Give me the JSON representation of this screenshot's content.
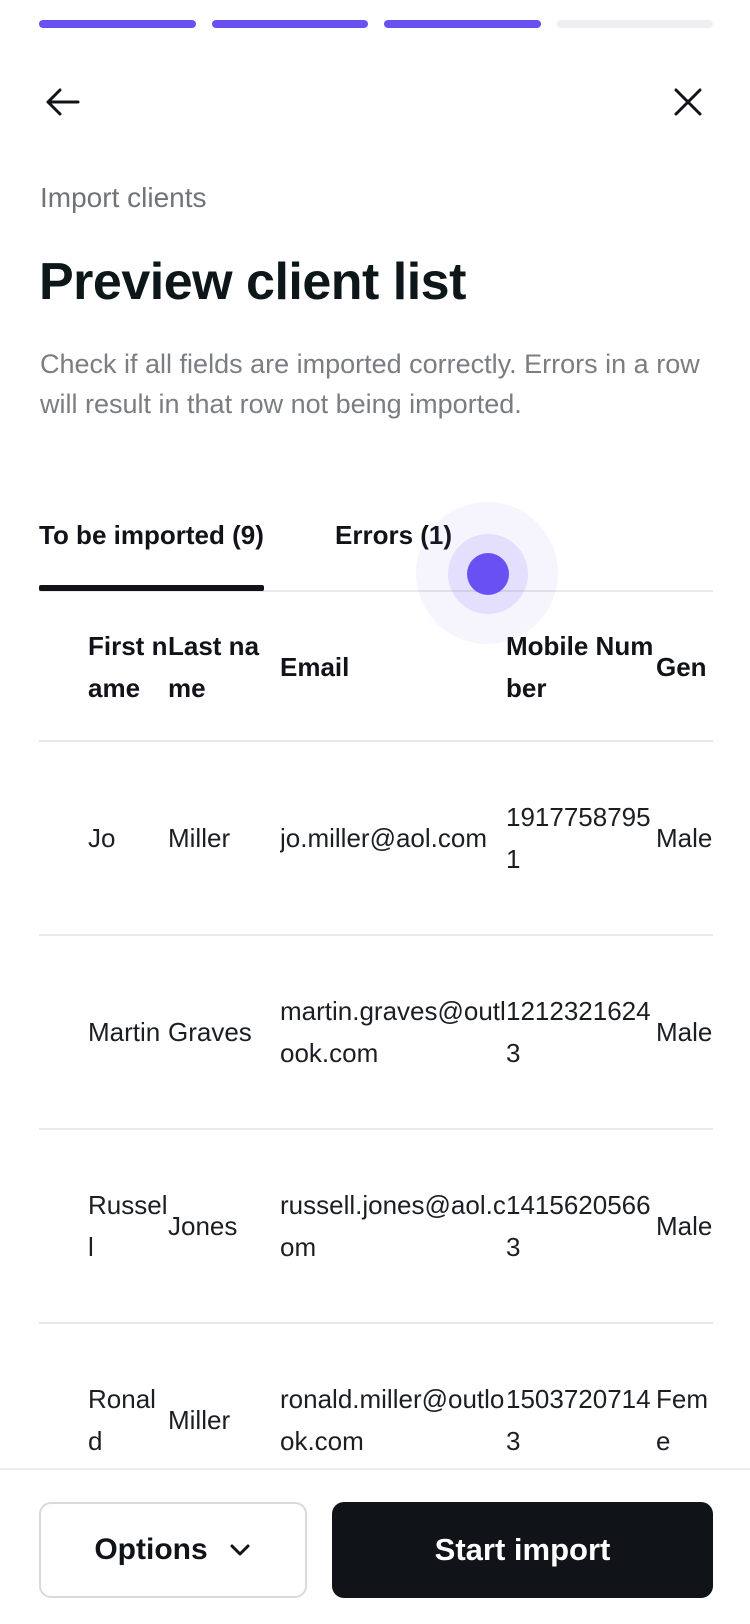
{
  "header": {
    "step_count": 4,
    "steps_completed": 3,
    "subtitle": "Import clients",
    "title": "Preview client list",
    "description": "Check if all fields are imported correctly. Errors in a row will result in that row not being imported."
  },
  "tabs": {
    "to_be_imported": "To be imported (9)",
    "errors": "Errors (1)"
  },
  "table": {
    "headers": {
      "first_name": "First name",
      "last_name": "Last name",
      "email": "Email",
      "mobile": "Mobile Number",
      "gender": "Gen"
    },
    "rows": [
      {
        "first": "Jo",
        "last": "Miller",
        "email": "jo.miller@aol.com",
        "mobile": "19177587951",
        "gender": "Male"
      },
      {
        "first": "Martin",
        "last": "Graves",
        "email": "martin.graves@outlook.com",
        "mobile": "12123216243",
        "gender": "Male"
      },
      {
        "first": "Russell",
        "last": "Jones",
        "email": "russell.jones@aol.com",
        "mobile": "14156205663",
        "gender": "Male"
      },
      {
        "first": "Ronald",
        "last": "Miller",
        "email": "ronald.miller@outlook.com",
        "mobile": "15037207143",
        "gender": "Feme"
      }
    ]
  },
  "footer": {
    "options_label": "Options",
    "start_label": "Start import"
  },
  "colors": {
    "accent": "#6950f3",
    "primary_button": "#101418",
    "progress_track": "#eeeef1"
  },
  "icons": {
    "back": "arrow-left-icon",
    "close": "close-icon",
    "options": "chevron-down-icon"
  }
}
